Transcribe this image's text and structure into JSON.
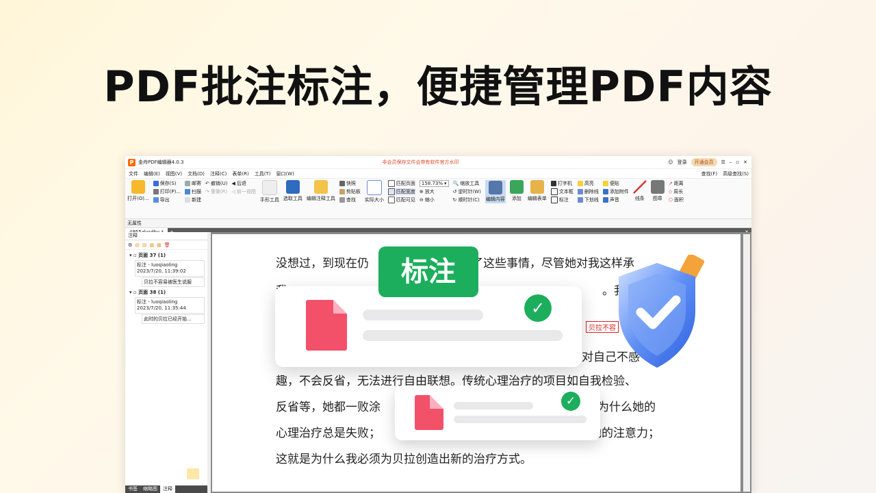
{
  "headline": "PDF批注标注，便捷管理PDF内容",
  "app": {
    "title": "金舟PDF编辑器4.0.3",
    "warning": "非会员保存文件会带有软件官方水印",
    "login": "登录",
    "vip": "开通会员",
    "menu": [
      "文件",
      "编辑(E)",
      "视图(V)",
      "文档(D)",
      "注释(C)",
      "表单(R)",
      "工具(T)",
      "窗口(W)"
    ],
    "menu_right": [
      "查找(F)",
      "高级查找(S)"
    ],
    "ribbon": {
      "open": "打开(O)...",
      "file_group": [
        "保存(S)",
        "打印(P)...",
        "导出"
      ],
      "mail_group": [
        "邮寄",
        "扫描",
        "新建"
      ],
      "undo_group": [
        "撤销(U)",
        "重做(R)"
      ],
      "nav_group": [
        "后退",
        "前一视图"
      ],
      "tools": [
        "手形工具",
        "选取工具",
        "编辑注释工具"
      ],
      "clip_group": [
        "快照",
        "剪贴板",
        "查找"
      ],
      "actual_size": "实际大小",
      "fit_group": [
        "匹配页面",
        "匹配宽度",
        "匹配可见"
      ],
      "zoom_value": "158.73%",
      "zoom_group": [
        "放大",
        "缩小"
      ],
      "rotate_group": [
        "缩放工具",
        "逆时针(W)",
        "顺时针(C)"
      ],
      "edit_content": "编辑内容",
      "add": "添加",
      "edit_form": "编辑表单",
      "anno_group1": [
        "打字机",
        "文本框",
        "标注"
      ],
      "anno_group2": [
        "高亮",
        "删除线",
        "下划线"
      ],
      "anno_group3": [
        "便贴",
        "添加附件",
        "声音"
      ],
      "lines": "线条",
      "stamp": "图章",
      "measure": [
        "距离",
        "周长",
        "面积"
      ]
    },
    "attr_label": "无属性",
    "tab_name": "4955zlysdhy *",
    "side": {
      "title": "注释",
      "pages": [
        {
          "label": "页面 37 (1)",
          "author": "标注 - luoqiaoling",
          "time": "2023/7/20, 11:39:02",
          "text": "贝拉不容易被医生说服"
        },
        {
          "label": "页面 38 (1)",
          "author": "标注 - luoqiaoling",
          "time": "2023/7/20, 11:35:44",
          "text": "此时的贝拉已经开始..."
        }
      ],
      "bottom_tabs": [
        "书签",
        "缩略图",
        "注释"
      ]
    },
    "doc_lines": [
      "没想过，到现在仍",
      "了这些事情，尽管她对我这样承",
      "我",
      "。我要",
      "对自己不感",
      "趣，不会反省，无法进行自由联想。传统心理治疗的项目如自我检验、",
      "反省等，她都一败涂",
      "是为什么她的",
      "心理治疗总是失败；",
      "她的注意力；",
      "这就是为什么我必须为贝拉创造出新的治疗方式。"
    ],
    "anno_tag": "贝拉不容"
  },
  "badge": "标注",
  "colors": {
    "accent_green": "#1cae5c",
    "pdf_red": "#f35069",
    "warning_red": "#e24a2b"
  }
}
